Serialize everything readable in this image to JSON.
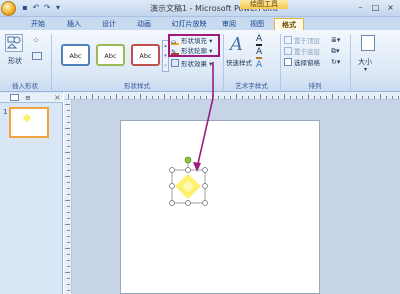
{
  "window": {
    "title": "演示文稿1 - Microsoft PowerPoint",
    "context_tab_group": "绘图工具",
    "qat_icons": [
      "save-icon",
      "undo-icon",
      "redo-icon",
      "qat-dropdown-icon"
    ],
    "controls": [
      "minimize",
      "maximize",
      "close"
    ]
  },
  "tabs": [
    "开始",
    "插入",
    "设计",
    "动画",
    "幻灯片放映",
    "审阅",
    "视图",
    "格式"
  ],
  "active_tab": "格式",
  "ribbon": {
    "insert_shapes": {
      "shapes_label": "形状",
      "group_label": "插入形状"
    },
    "shape_styles": {
      "samples": [
        "Abc",
        "Abc",
        "Abc"
      ],
      "sample_border_colors": [
        "#4f81bd",
        "#9bbb59",
        "#c0504d"
      ],
      "fill_label": "形状填充",
      "outline_label": "形状轮廓",
      "effects_label": "形状效果",
      "group_label": "形状样式",
      "highlight_color": "#a0197f"
    },
    "wordart": {
      "quick_styles_label": "快速样式",
      "group_label": "艺术字样式"
    },
    "arrange": {
      "bring_front_label": "置于顶层",
      "send_back_label": "置于底层",
      "selection_pane_label": "选择窗格",
      "group_label": "排列"
    },
    "size": {
      "label": "大小"
    }
  },
  "left_pane": {
    "slide_number": "1"
  },
  "colors": {
    "annotation": "#a0197f",
    "shape_fill": "#fff06a",
    "handle": "#8dc63f",
    "thumbnail_border": "#f1a340"
  }
}
